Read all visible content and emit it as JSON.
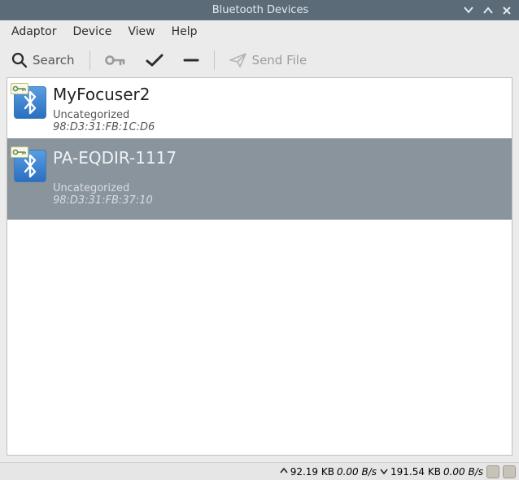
{
  "window": {
    "title": "Bluetooth Devices"
  },
  "menubar": {
    "items": [
      "Adaptor",
      "Device",
      "View",
      "Help"
    ]
  },
  "toolbar": {
    "search_label": "Search",
    "send_label": "Send File",
    "icons": {
      "search": "search-icon",
      "key": "key-icon",
      "check": "check-icon",
      "minus": "minus-icon",
      "send": "paper-plane-icon"
    }
  },
  "devices": [
    {
      "name": "MyFocuser2",
      "category": "Uncategorized",
      "address": "98:D3:31:FB:1C:D6",
      "paired": true,
      "selected": false
    },
    {
      "name": "PA-EQDIR-1117",
      "category": "Uncategorized",
      "address": "98:D3:31:FB:37:10",
      "paired": true,
      "selected": true
    }
  ],
  "statusbar": {
    "up_bytes": "92.19 KB",
    "up_rate": "0.00 B/s",
    "down_bytes": "191.54 KB",
    "down_rate": "0.00 B/s"
  }
}
